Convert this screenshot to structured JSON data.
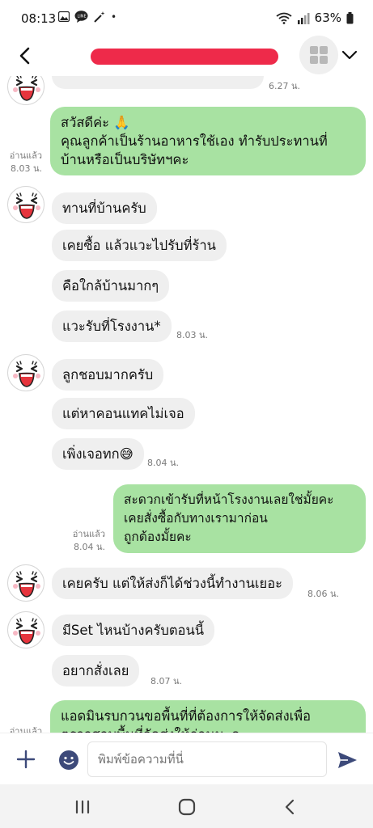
{
  "status_bar": {
    "time": "08:13",
    "battery": "63%",
    "dot": "•"
  },
  "header": {
    "title": "",
    "back_icon": "chevron-left-icon",
    "apps_icon": "grid-icon",
    "menu_icon": "chevron-down-icon"
  },
  "colors": {
    "outgoing_bubble": "#a8e2a2",
    "incoming_bubble": "#efefef",
    "redaction": "#ee2a4a",
    "send": "#3d4a7a"
  },
  "messages": [
    {
      "id": "m0",
      "dir": "in",
      "text": "",
      "time": "6.27 น."
    },
    {
      "id": "m1",
      "dir": "out",
      "lines": [
        "สวัสดีค่ะ 🙏",
        "คุณลูกค้าเป็นร้านอาหารใช้เอง ทำรับประทานที่",
        "บ้านหรือเป็นบริษัทฯคะ"
      ],
      "read": "อ่านแล้ว",
      "time": "8.03 น."
    },
    {
      "id": "m2",
      "dir": "in",
      "text": "ทานที่บ้านครับ"
    },
    {
      "id": "m3",
      "dir": "in",
      "text": "เคยซื้อ แล้วแวะไปรับที่ร้าน"
    },
    {
      "id": "m4",
      "dir": "in",
      "text": "คือใกล้บ้านมากๆ"
    },
    {
      "id": "m5",
      "dir": "in",
      "text": "แวะรับที่โรงงาน*",
      "time": "8.03 น."
    },
    {
      "id": "m6",
      "dir": "in",
      "text": "ลูกชอบมากครับ"
    },
    {
      "id": "m7",
      "dir": "in",
      "text": "แต่หาคอนแทคไม่เจอ"
    },
    {
      "id": "m8",
      "dir": "in",
      "text": "เพิ่งเจอทก😅",
      "time": "8.04 น."
    },
    {
      "id": "m9",
      "dir": "out",
      "lines": [
        "สะดวกเข้ารับที่หน้าโรงงานเลยใช่มั้ยคะ",
        "เคยสั่งซื้อกับทางเรามาก่อน",
        "ถูกต้องมั้ยคะ"
      ],
      "read": "อ่านแล้ว",
      "time": "8.04 น."
    },
    {
      "id": "m10",
      "dir": "in",
      "text": "เคยครับ แต่ให้ส่งก็ได้ช่วงนี้ทำงานเยอะ",
      "time": "8.06 น."
    },
    {
      "id": "m11",
      "dir": "in",
      "text": "มีSet ไหนบ้างครับตอนนี้"
    },
    {
      "id": "m12",
      "dir": "in",
      "text": "อยากสั่งเลย",
      "time": "8.07 น."
    },
    {
      "id": "m13",
      "dir": "out",
      "lines": [
        "แอดมินรบกวนขอพื้นที่ที่ต้องการให้จัดส่งเพื่อ",
        "ตรวจสอบพื้นที่จัดส่งให้ก่อนนะคะ"
      ],
      "read": "อ่านแล้ว",
      "time": ""
    }
  ],
  "composer": {
    "placeholder": "พิมพ์ข้อความที่นี่",
    "plus_icon": "plus-icon",
    "emoji_icon": "emoji-icon",
    "send_icon": "send-icon"
  },
  "nav": {
    "recents_icon": "recents-icon",
    "home_icon": "home-icon",
    "back_icon": "back-icon"
  }
}
